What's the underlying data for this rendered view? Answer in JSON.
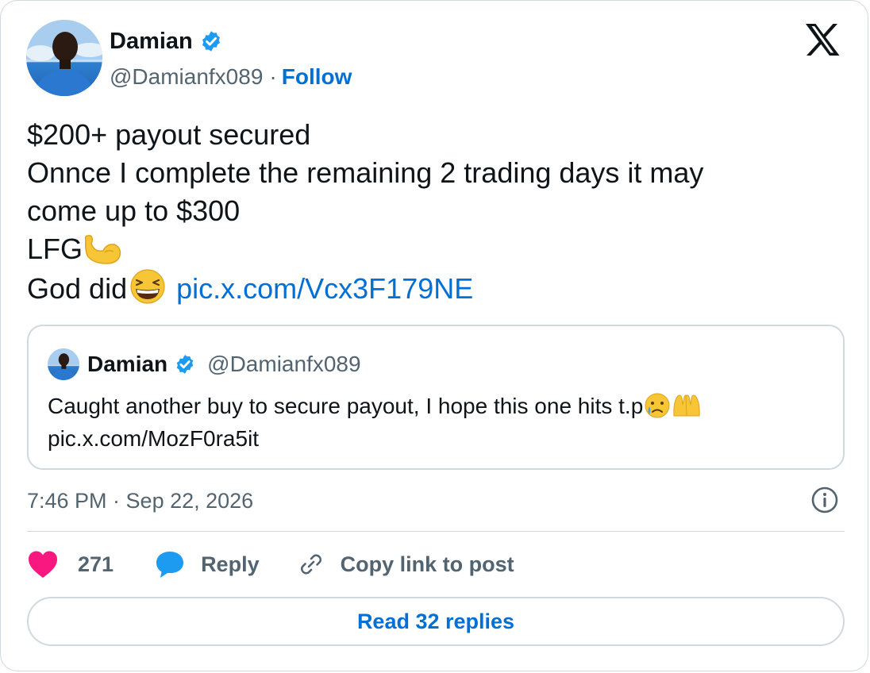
{
  "author": {
    "name": "Damian",
    "handle": "@Damianfx089",
    "separator": "·",
    "follow_label": "Follow"
  },
  "post": {
    "line1": "$200+ payout secured",
    "line2": "Onnce I complete the remaining 2 trading days it may",
    "line3": "come up to $300",
    "line4": "LFG",
    "line4_emoji": "flexed-biceps",
    "line5": "God did",
    "line5_emoji": "grinning-squinting-face",
    "link": "pic.x.com/Vcx3F179NE"
  },
  "quote": {
    "name": "Damian",
    "handle": "@Damianfx089",
    "text": "Caught another buy to secure payout, I hope this one hits t.p",
    "emojis": [
      "crying-face",
      "palms-up-together"
    ],
    "link": "pic.x.com/MozF0ra5it"
  },
  "timestamp": "7:46 PM · Sep 22, 2026",
  "actions": {
    "like_count": "271",
    "reply_label": "Reply",
    "copy_label": "Copy link to post"
  },
  "read_replies_label": "Read 32 replies",
  "colors": {
    "link": "#006fd6",
    "verified": "#1d9bf0",
    "like": "#f91880",
    "secondary_text": "#536471",
    "border": "#cfd9de"
  }
}
